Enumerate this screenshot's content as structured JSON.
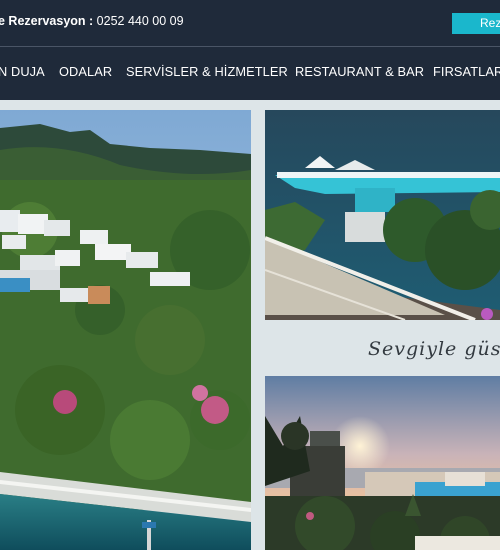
{
  "topbar": {
    "reservation_label": "e Rezervasyon :",
    "reservation_phone": " 0252 440 00 09",
    "cta_label": "Rez"
  },
  "nav": {
    "items": [
      {
        "label": "N DUJA"
      },
      {
        "label": "ODALAR"
      },
      {
        "label": "SERVİSLER & HİZMETLER"
      },
      {
        "label": "RESTAURANT & BAR"
      },
      {
        "label": "FIRSATLAR"
      }
    ]
  },
  "gallery": {
    "tagline": "Sevgiyle güs"
  },
  "colors": {
    "header_bg": "#1f2a3a",
    "accent": "#1ab7cc",
    "page_bg": "#dde5e8"
  }
}
